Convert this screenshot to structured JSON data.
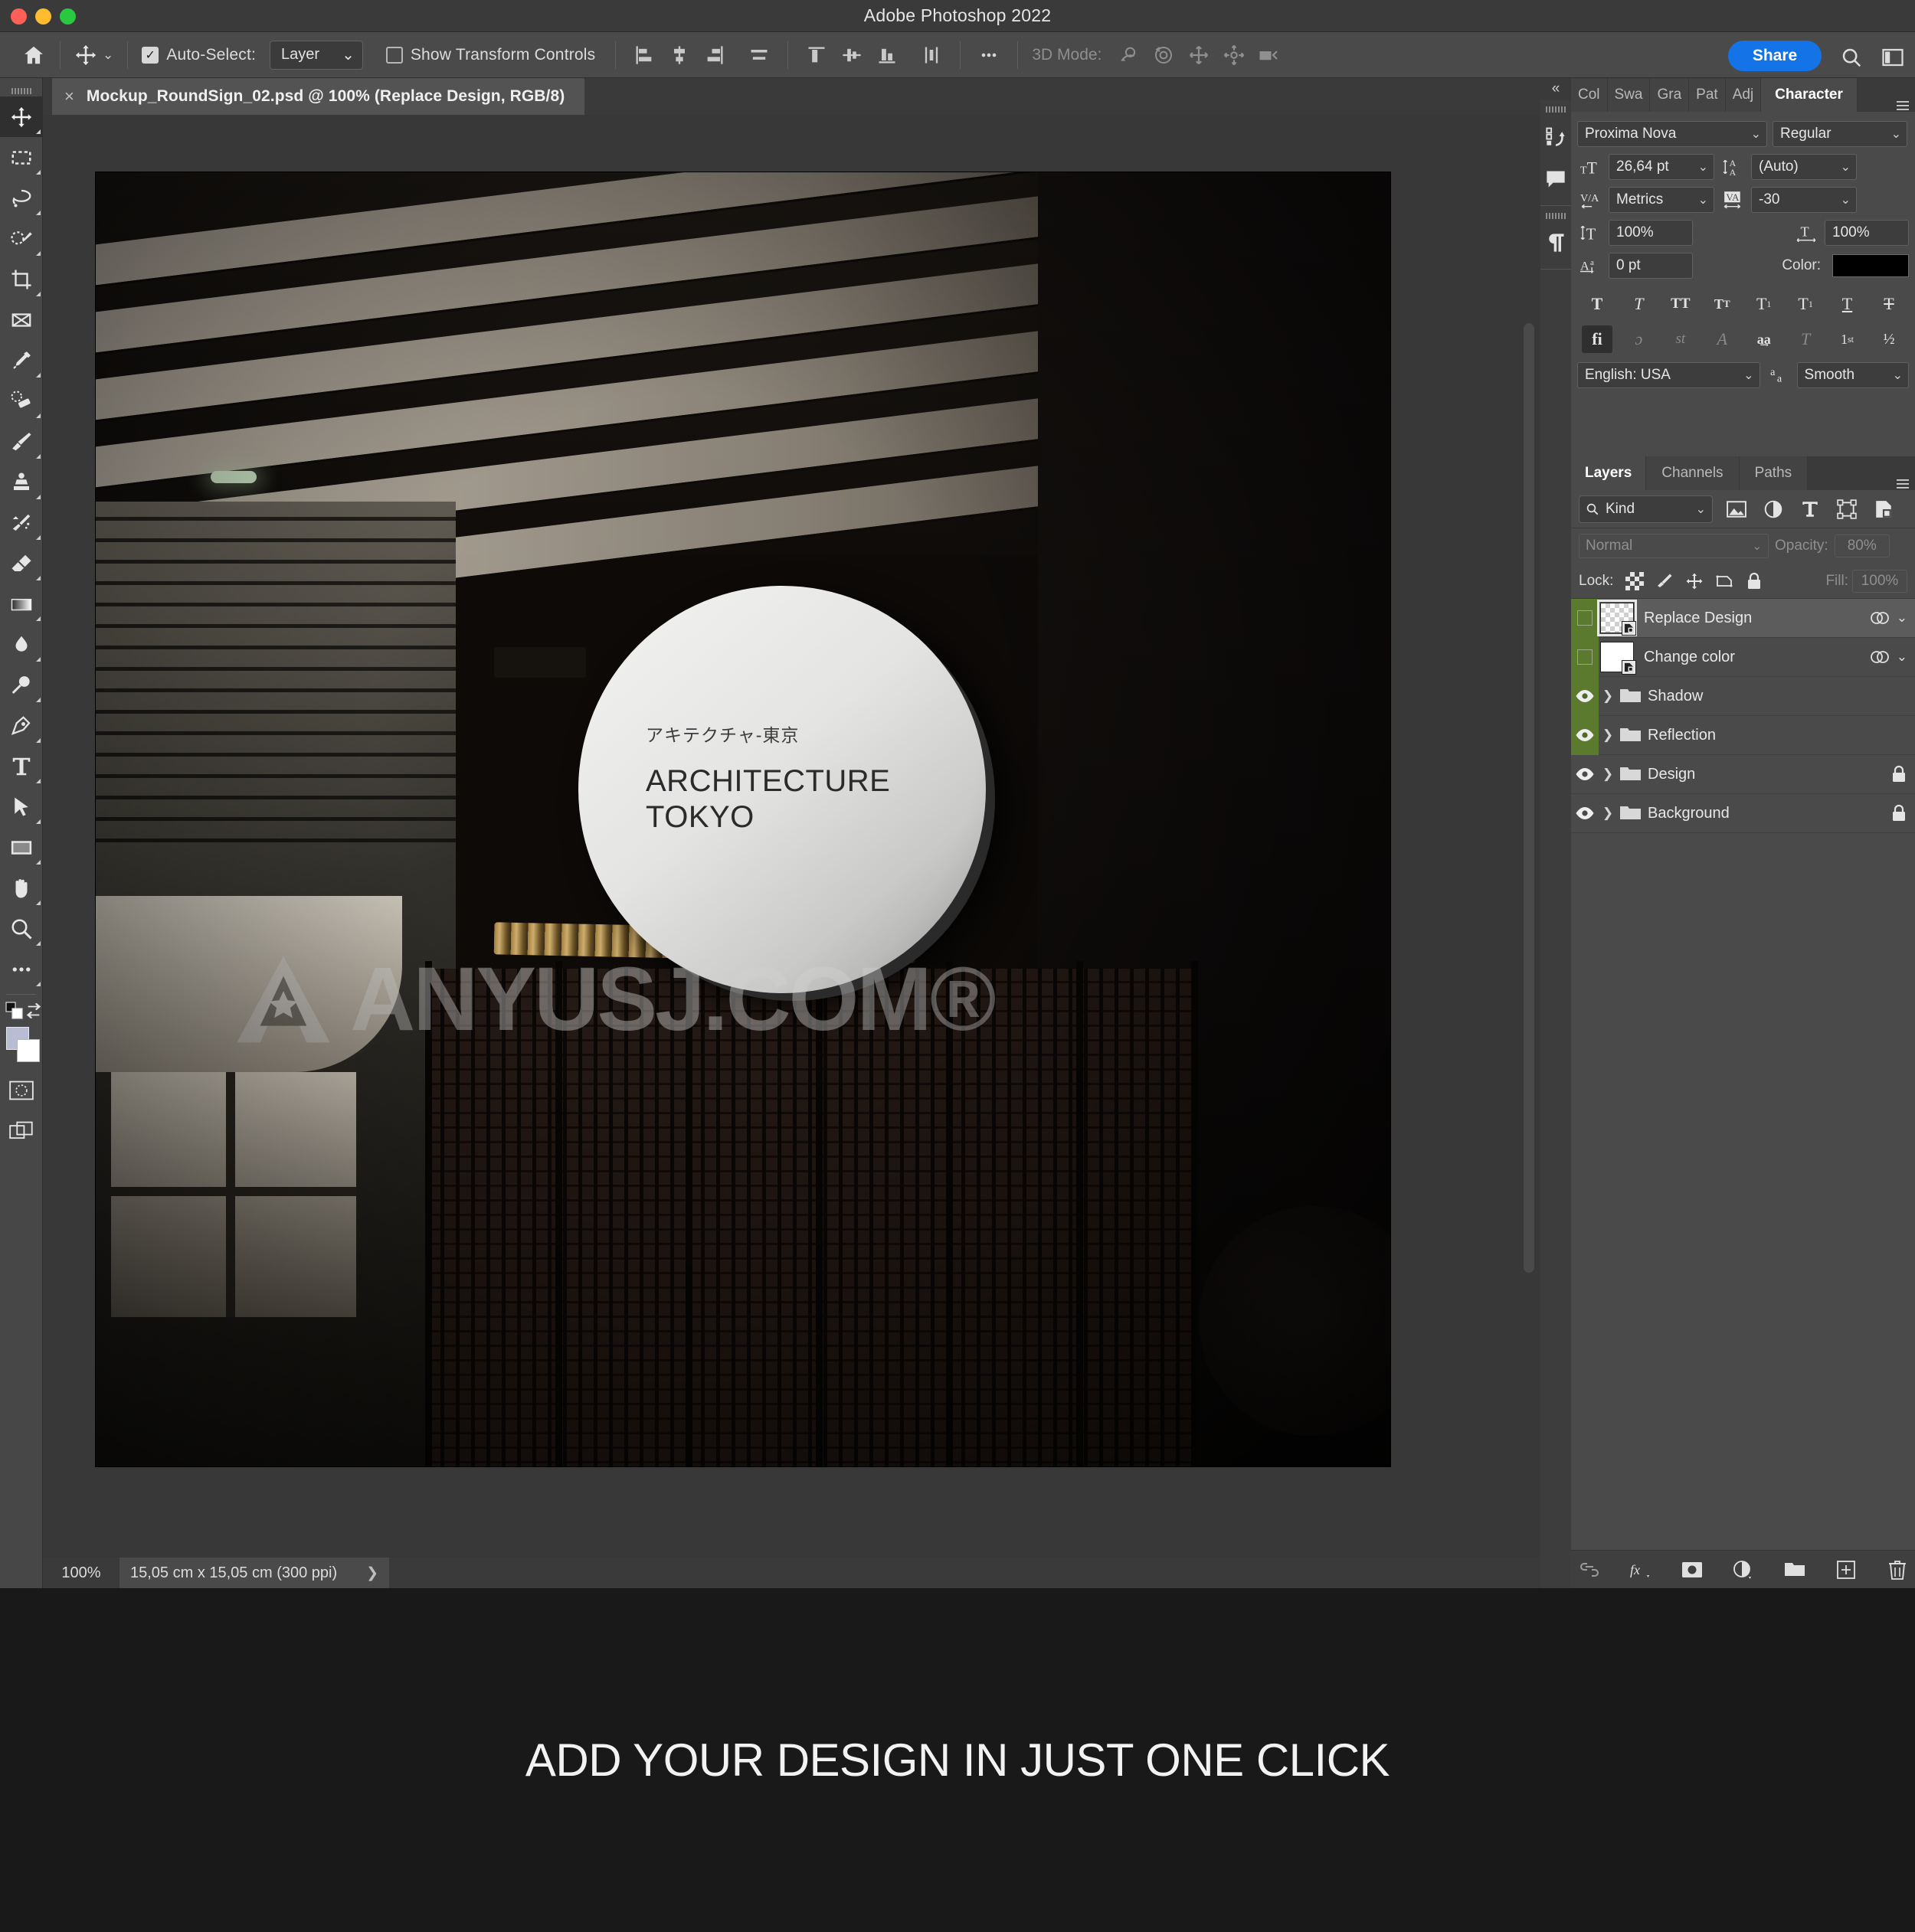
{
  "window": {
    "app_title": "Adobe Photoshop 2022"
  },
  "options_bar": {
    "home_icon": "home-icon",
    "move_tool_icon": "move-tool-icon",
    "auto_select_label": "Auto-Select:",
    "auto_select_checked": true,
    "auto_select_value": "Layer",
    "show_transform_label": "Show Transform Controls",
    "show_transform_checked": false,
    "align_icons": [
      "align-left-edges-icon",
      "align-horizontal-centers-icon",
      "align-right-edges-icon",
      "distribute-horizontal-icon",
      "align-top-edges-icon",
      "align-vertical-centers-icon",
      "align-bottom-edges-icon",
      "distribute-vertical-icon"
    ],
    "more_icon": "more-options-icon",
    "mode_3d_label": "3D Mode:",
    "mode_3d_icons": [
      "orbit-3d-icon",
      "roll-3d-icon",
      "pan-3d-icon",
      "slide-3d-icon",
      "camera-3d-icon"
    ],
    "share_label": "Share",
    "search_icon": "search-icon",
    "workspace_icon": "workspace-switcher-icon",
    "accent_color": "#1473e6"
  },
  "toolbar": {
    "tools": [
      {
        "name": "move-tool",
        "selected": true,
        "hidden_more": true
      },
      {
        "name": "rectangular-marquee-tool",
        "selected": false,
        "hidden_more": true
      },
      {
        "name": "lasso-tool",
        "selected": false,
        "hidden_more": true
      },
      {
        "name": "object-selection-tool",
        "selected": false,
        "hidden_more": true
      },
      {
        "name": "crop-tool",
        "selected": false,
        "hidden_more": true
      },
      {
        "name": "frame-tool",
        "selected": false,
        "hidden_more": false
      },
      {
        "name": "eyedropper-tool",
        "selected": false,
        "hidden_more": true
      },
      {
        "name": "spot-healing-brush-tool",
        "selected": false,
        "hidden_more": true
      },
      {
        "name": "brush-tool",
        "selected": false,
        "hidden_more": true
      },
      {
        "name": "clone-stamp-tool",
        "selected": false,
        "hidden_more": true
      },
      {
        "name": "history-brush-tool",
        "selected": false,
        "hidden_more": true
      },
      {
        "name": "eraser-tool",
        "selected": false,
        "hidden_more": true
      },
      {
        "name": "gradient-tool",
        "selected": false,
        "hidden_more": true
      },
      {
        "name": "blur-tool",
        "selected": false,
        "hidden_more": true
      },
      {
        "name": "dodge-tool",
        "selected": false,
        "hidden_more": true
      },
      {
        "name": "pen-tool",
        "selected": false,
        "hidden_more": true
      },
      {
        "name": "type-tool",
        "selected": false,
        "hidden_more": true
      },
      {
        "name": "path-selection-tool",
        "selected": false,
        "hidden_more": true
      },
      {
        "name": "rectangle-tool",
        "selected": false,
        "hidden_more": true
      },
      {
        "name": "hand-tool",
        "selected": false,
        "hidden_more": true
      },
      {
        "name": "zoom-tool",
        "selected": false,
        "hidden_more": true
      },
      {
        "name": "edit-toolbar-tool",
        "selected": false,
        "hidden_more": true
      }
    ],
    "default_colors_icon": "default-foreground-background-icon",
    "swap_colors_icon": "swap-foreground-background-icon",
    "foreground_color": "#b9bdd4",
    "background_color": "#ffffff",
    "quick_mask_icon": "quick-mask-mode-icon",
    "screen_mode_icon": "screen-mode-icon"
  },
  "document": {
    "tab_title": "Mockup_RoundSign_02.psd @ 100% (Replace Design, RGB/8)",
    "close_icon": "close-icon"
  },
  "status_bar": {
    "zoom": "100%",
    "doc_size": "15,05 cm x 15,05 cm (300 ppi)",
    "expand_icon": "chevron-right-icon"
  },
  "canvas": {
    "sign": {
      "japanese_line": "アキテクチャ-東京",
      "line1": "ARCHITECTURE",
      "line2": "TOKYO"
    },
    "watermark": {
      "logo": "star-a-logo-icon",
      "text": "ANYUSJ.COM®"
    }
  },
  "dock": {
    "collapse_icon": "collapse-panels-icon",
    "icons": [
      "history-actions-icon",
      "comments-icon",
      "paragraph-icon"
    ]
  },
  "character_panel": {
    "tabs": [
      {
        "label": "Col",
        "active": false
      },
      {
        "label": "Swa",
        "active": false
      },
      {
        "label": "Gra",
        "active": false
      },
      {
        "label": "Pat",
        "active": false
      },
      {
        "label": "Adj",
        "active": false
      },
      {
        "label": "Character",
        "active": true
      }
    ],
    "menu_icon": "panel-menu-icon",
    "font_family": "Proxima Nova",
    "font_style": "Regular",
    "font_size_icon": "font-size-icon",
    "font_size": "26,64 pt",
    "leading_icon": "leading-icon",
    "leading": "(Auto)",
    "kerning_icon": "kerning-icon",
    "kerning": "Metrics",
    "tracking_icon": "tracking-icon",
    "tracking": "-30",
    "vertical_scale_icon": "vertical-scale-icon",
    "vertical_scale": "100%",
    "horizontal_scale_icon": "horizontal-scale-icon",
    "horizontal_scale": "100%",
    "baseline_shift_icon": "baseline-shift-icon",
    "baseline_shift": "0 pt",
    "color_label": "Color:",
    "color_value": "#000000",
    "style_buttons": [
      {
        "name": "faux-bold-button",
        "glyph": "T",
        "active": false
      },
      {
        "name": "faux-italic-button",
        "glyph": "T",
        "active": false
      },
      {
        "name": "all-caps-button",
        "glyph": "TT",
        "active": false
      },
      {
        "name": "small-caps-button",
        "glyph": "Tᴛ",
        "active": false
      },
      {
        "name": "superscript-button",
        "glyph": "T¹",
        "active": false
      },
      {
        "name": "subscript-button",
        "glyph": "T₁",
        "active": false
      },
      {
        "name": "underline-button",
        "glyph": "T",
        "active": false
      },
      {
        "name": "strikethrough-button",
        "glyph": "T",
        "active": false
      }
    ],
    "opentype_buttons": [
      {
        "name": "standard-ligatures-button",
        "glyph": "fi",
        "active": true
      },
      {
        "name": "contextual-alternates-button",
        "glyph": "ɔ",
        "active": false
      },
      {
        "name": "discretionary-ligatures-button",
        "glyph": "st",
        "active": false
      },
      {
        "name": "swash-button",
        "glyph": "𝒜",
        "active": false
      },
      {
        "name": "oldstyle-button",
        "glyph": "aa",
        "active": false
      },
      {
        "name": "titling-alternates-button",
        "glyph": "T",
        "active": false
      },
      {
        "name": "ordinals-button",
        "glyph": "1st",
        "active": false
      },
      {
        "name": "fractions-button",
        "glyph": "½",
        "active": false
      }
    ],
    "language": "English: USA",
    "antialias_icon": "anti-aliasing-icon",
    "antialias": "Smooth"
  },
  "layers_panel": {
    "tabs": [
      {
        "label": "Layers",
        "active": true
      },
      {
        "label": "Channels",
        "active": false
      },
      {
        "label": "Paths",
        "active": false
      }
    ],
    "menu_icon": "panel-menu-icon",
    "filter": {
      "search_icon": "search-icon",
      "kind_label": "Kind",
      "icons": [
        "filter-pixel-icon",
        "filter-adjustment-icon",
        "filter-type-icon",
        "filter-shape-icon",
        "filter-smart-object-icon"
      ]
    },
    "blend_mode": "Normal",
    "opacity_label": "Opacity:",
    "opacity_value": "80%",
    "lock_label": "Lock:",
    "lock_icons": [
      "lock-transparent-pixels-icon",
      "lock-image-pixels-icon",
      "lock-position-icon",
      "lock-artboard-nesting-icon",
      "lock-all-icon"
    ],
    "fill_label": "Fill:",
    "fill_value": "100%",
    "layers": [
      {
        "name": "Replace Design",
        "type": "smart-object",
        "visible": false,
        "selected": true,
        "thumb": "transparent",
        "has_fx": false,
        "link_icon": "layer-link-icon",
        "expand_icon": "chevron-down-icon",
        "locked": false,
        "green_strip": true
      },
      {
        "name": "Change color",
        "type": "smart-object",
        "visible": false,
        "selected": false,
        "thumb": "white",
        "has_fx": false,
        "link_icon": "layer-link-icon",
        "expand_icon": "chevron-down-icon",
        "locked": false,
        "green_strip": true
      },
      {
        "name": "Shadow",
        "type": "group",
        "visible": true,
        "selected": false,
        "locked": false,
        "green_strip": true
      },
      {
        "name": "Reflection",
        "type": "group",
        "visible": true,
        "selected": false,
        "locked": false,
        "green_strip": true
      },
      {
        "name": "Design",
        "type": "group",
        "visible": true,
        "selected": false,
        "locked": true,
        "green_strip": false
      },
      {
        "name": "Background",
        "type": "group",
        "visible": true,
        "selected": false,
        "locked": true,
        "green_strip": false
      }
    ],
    "bottom_icons": [
      "link-layers-icon",
      "add-layer-style-icon",
      "add-layer-mask-icon",
      "new-adjustment-layer-icon",
      "new-group-icon",
      "new-layer-icon",
      "delete-layer-icon"
    ]
  },
  "footer": {
    "caption": "ADD YOUR DESIGN IN JUST ONE CLICK"
  }
}
